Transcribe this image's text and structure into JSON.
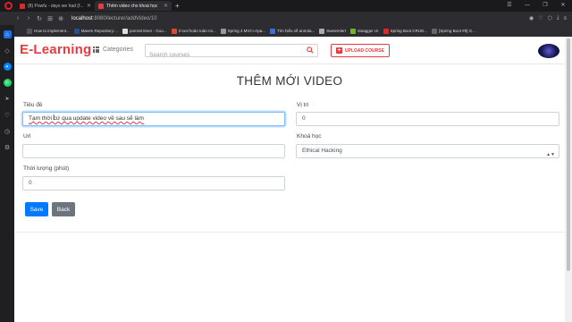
{
  "browser": {
    "tabs": [
      {
        "title": "(8) Powfu - days we had (f...",
        "color": "#e02828"
      },
      {
        "title": "Thêm video cho khoá học",
        "color": "#e63b40",
        "active": true
      }
    ],
    "url_host": "localhost",
    "url_path": ":8080/lecturer/addVideo/10",
    "bookmarks": [
      {
        "label": "How to implement...",
        "color": "#555"
      },
      {
        "label": "Maven Repository:...",
        "color": "#2a4f8f"
      },
      {
        "label": "pomrat timer - Goo...",
        "color": "#ddd"
      },
      {
        "label": "3 tool hoàn toàn mi...",
        "color": "#d94b2b"
      },
      {
        "label": "Spring 4 MVC+Apa...",
        "color": "#999"
      },
      {
        "label": "Tìm hiểu về annota...",
        "color": "#3b6fcf"
      },
      {
        "label": "SweetAlert",
        "color": "#aaa"
      },
      {
        "label": "Swagger UI",
        "color": "#6fb52c"
      },
      {
        "label": "Spring Boot CRUD...",
        "color": "#e02828"
      },
      {
        "label": "[Spring Boot #9] G...",
        "color": "#666"
      }
    ]
  },
  "navbar": {
    "brand": "E-Learning",
    "categories_label": "Categories",
    "search_placeholder": "Search courses",
    "upload_label": "UPLOAD COURSE"
  },
  "form": {
    "heading": "THÊM MỚI VIDEO",
    "title_label": "Tiêu đề",
    "title_value": "Tạm thời cứ qua update video về sau sẽ làm",
    "position_label": "Vị trí",
    "position_value": "0",
    "url_label": "Url",
    "url_value": "",
    "course_label": "Khoá học",
    "course_value": "Ethical Hacking",
    "duration_label": "Thời lượng (phút)",
    "duration_value": "0",
    "save_label": "Save",
    "back_label": "Back"
  },
  "colors": {
    "brand": "#e63b40",
    "primary": "#007bff",
    "secondary": "#6c757d"
  }
}
